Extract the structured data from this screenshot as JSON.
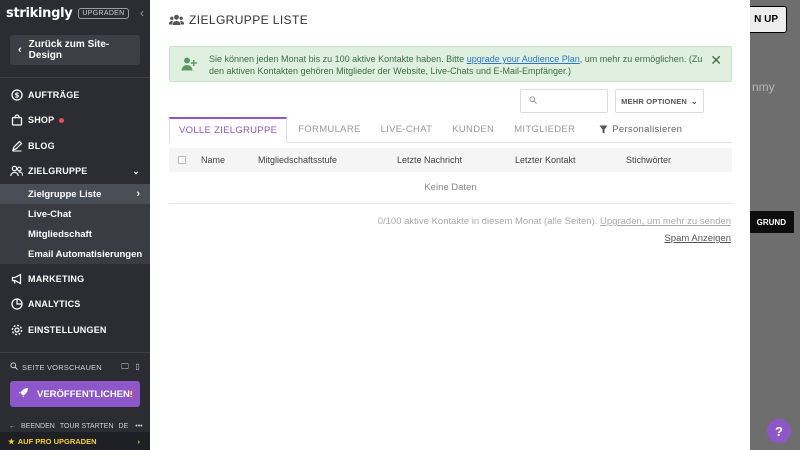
{
  "sidebar": {
    "logo": "strikingly",
    "upgrade_badge": "UPGRADEN",
    "back_label": "Zurück zum Site-Design",
    "items": [
      {
        "label": "AUFTRÄGE"
      },
      {
        "label": "SHOP"
      },
      {
        "label": "BLOG"
      },
      {
        "label": "ZIELGRUPPE"
      },
      {
        "label": "MARKETING"
      },
      {
        "label": "ANALYTICS"
      },
      {
        "label": "EINSTELLUNGEN"
      }
    ],
    "subitems": [
      {
        "label": "Zielgruppe Liste"
      },
      {
        "label": "Live-Chat"
      },
      {
        "label": "Mitgliedschaft"
      },
      {
        "label": "Email Automatisierungen"
      }
    ],
    "preview_label": "SEITE VORSCHAUEN",
    "publish_label": "VERÖFFENTLICHEN",
    "publish_warning": "!",
    "footer": {
      "exit": "BEENDEN",
      "tour": "TOUR STARTEN",
      "lang": "DE",
      "more": "•••"
    },
    "upgrade_pro": "AUF PRO UPGRADEN"
  },
  "background": {
    "button_fragment": "N UP",
    "word_fragment": "nmy",
    "dark_button_fragment": "GRUND"
  },
  "panel": {
    "title": "ZIELGRUPPE LISTE",
    "alert": {
      "text_before": "Sie können jeden Monat bis zu 100 aktive Kontakte haben. Bitte ",
      "link": "upgrade your Audience Plan",
      "text_after": ", um mehr zu ermöglichen. (Zu den aktiven Kontakten gehören Mitglieder der Website, Live-Chats und E-Mail-Empfänger.)"
    },
    "search_placeholder": "",
    "more_options": "MEHR OPTIONEN",
    "tabs": [
      {
        "label": "VOLLE ZIELGRUPPE"
      },
      {
        "label": "FORMULARE"
      },
      {
        "label": "LIVE-CHAT"
      },
      {
        "label": "KUNDEN"
      },
      {
        "label": "MITGLIEDER"
      },
      {
        "label": "Personalisieren"
      }
    ],
    "table": {
      "columns": [
        "Name",
        "Mitgliedschaftsstufe",
        "Letzte Nachricht",
        "Letzter Kontakt",
        "Stichwörter"
      ],
      "empty_text": "Keine Daten"
    },
    "status_text": "0/100 aktive Kontakte in diesem Monat (alle Seiten). ",
    "status_link": "Upgraden, um mehr zu senden",
    "spam_link": "Spam Anzeigen"
  },
  "help_label": "?",
  "colors": {
    "accent_purple": "#8e57c9",
    "sidebar_bg": "#2b2d33",
    "alert_bg": "#dff0e0",
    "upgrade_yellow": "#f5d030",
    "notification_red": "#e74c5c"
  }
}
